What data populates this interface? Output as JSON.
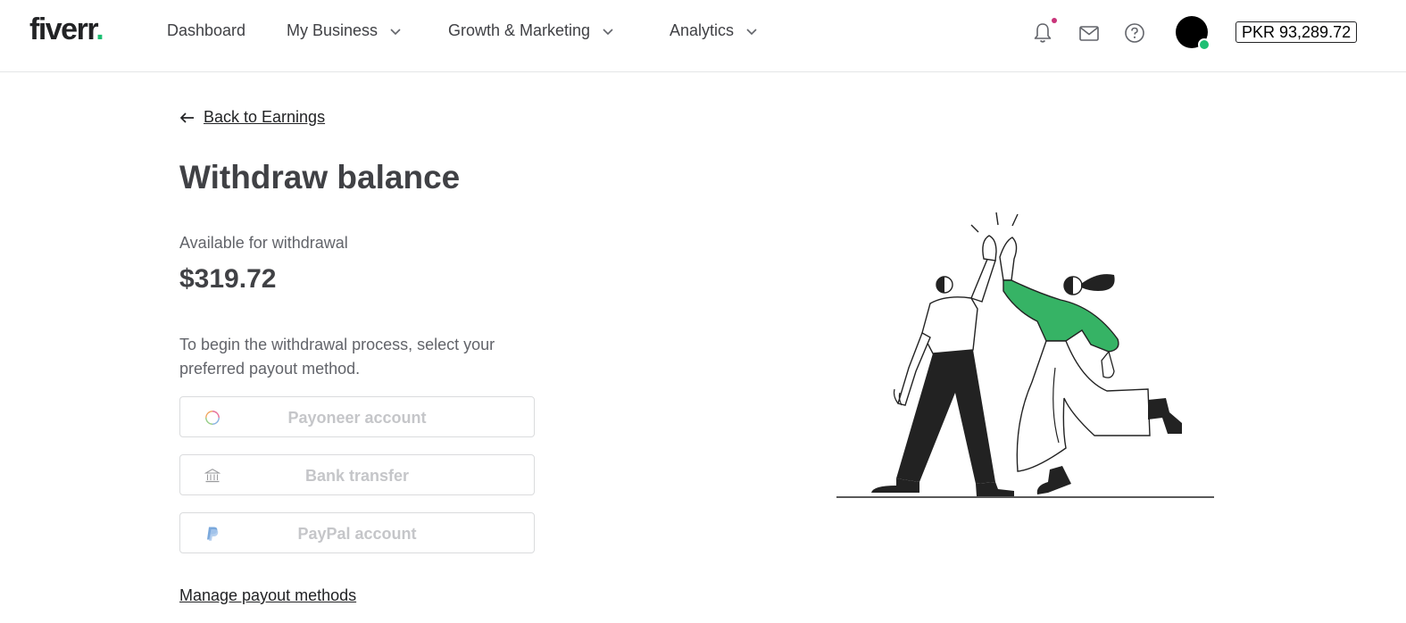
{
  "header": {
    "logo_text": "fiverr",
    "logo_dot": ".",
    "nav": [
      {
        "label": "Dashboard"
      },
      {
        "label": "My Business"
      },
      {
        "label": "Growth & Marketing"
      },
      {
        "label": "Analytics"
      }
    ],
    "balance": "PKR 93,289.72"
  },
  "main": {
    "back_label": "Back to Earnings",
    "title": "Withdraw balance",
    "available_label": "Available for withdrawal",
    "available_amount": "$319.72",
    "instructions": "To begin the withdrawal process, select your preferred payout method.",
    "methods": [
      {
        "label": "Payoneer account",
        "icon": "payoneer-icon"
      },
      {
        "label": "Bank transfer",
        "icon": "bank-icon"
      },
      {
        "label": "PayPal account",
        "icon": "paypal-icon"
      }
    ],
    "manage_label": "Manage payout methods"
  },
  "colors": {
    "brand_green": "#1dbf73",
    "text_dark": "#404145",
    "disabled_text": "#c5c6c9",
    "notification_dot": "#c9347a"
  }
}
